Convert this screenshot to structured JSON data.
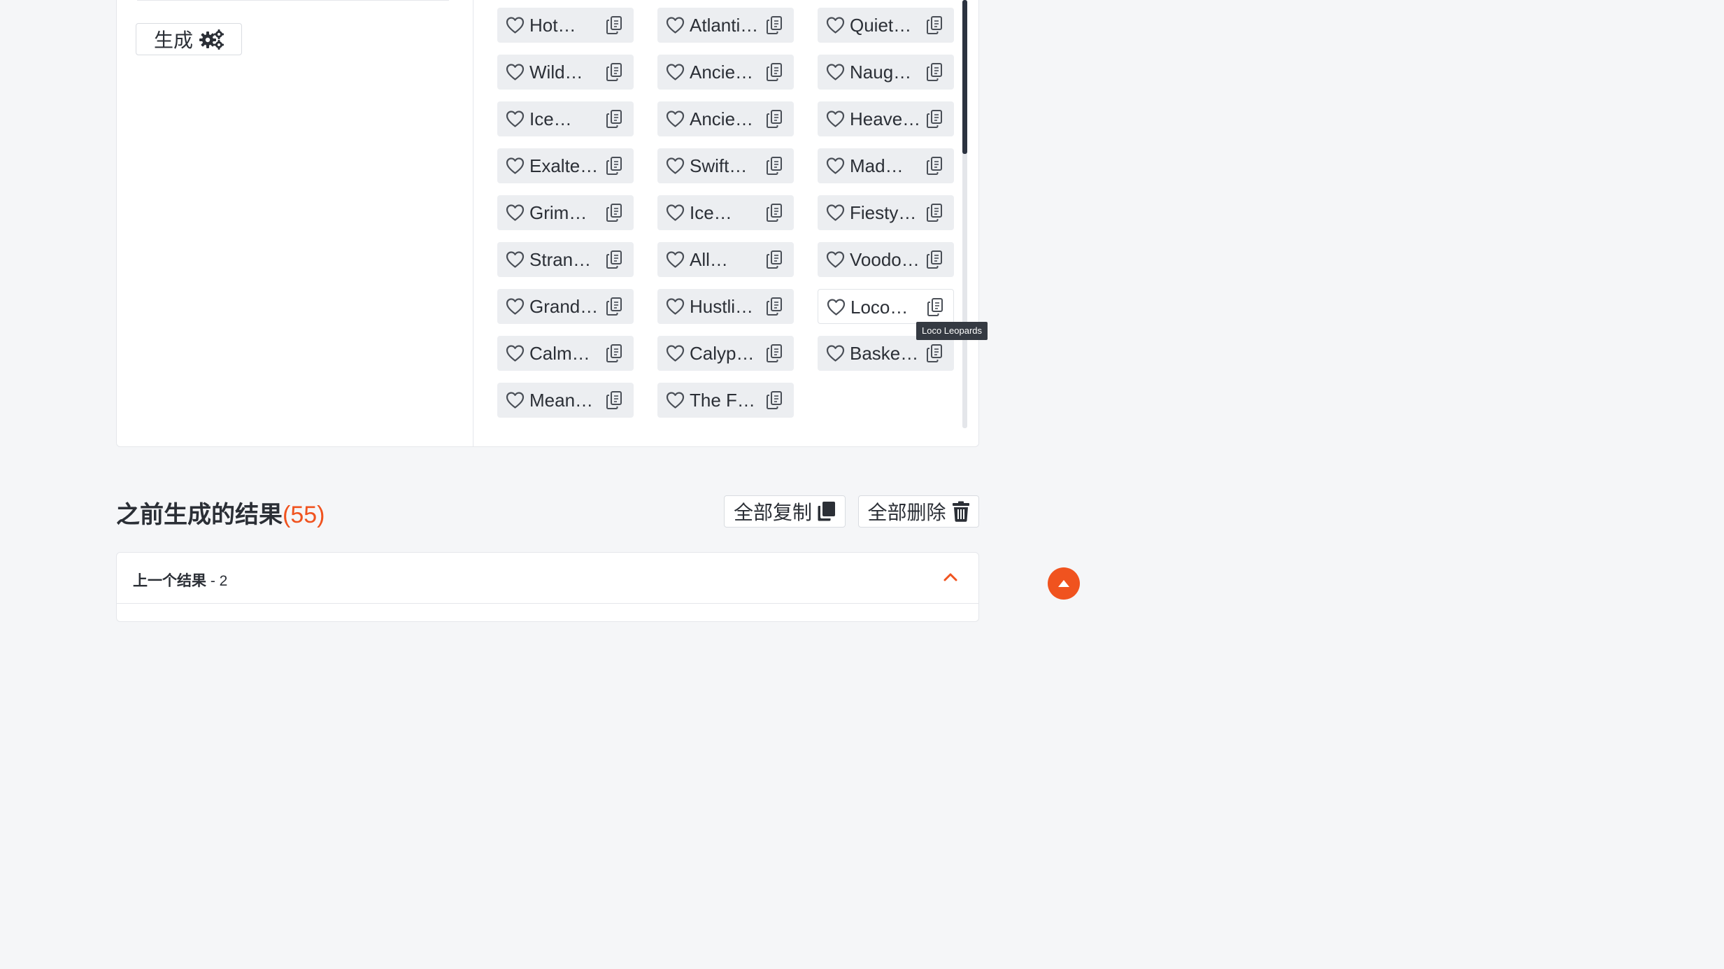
{
  "generator": {
    "generate_label": "生成",
    "generate_icon": "gears-icon"
  },
  "names": [
    {
      "label": "Hot…"
    },
    {
      "label": "Atlanti…"
    },
    {
      "label": "Quiet…"
    },
    {
      "label": "Wild…"
    },
    {
      "label": "Ancie…"
    },
    {
      "label": "Naug…"
    },
    {
      "label": "Ice…"
    },
    {
      "label": "Ancie…"
    },
    {
      "label": "Heave…"
    },
    {
      "label": "Exalte…"
    },
    {
      "label": "Swift…"
    },
    {
      "label": "Mad…"
    },
    {
      "label": "Grim…"
    },
    {
      "label": "Ice…"
    },
    {
      "label": "Fiesty…"
    },
    {
      "label": "Stran…"
    },
    {
      "label": "All…"
    },
    {
      "label": "Voodo…"
    },
    {
      "label": "Grand…"
    },
    {
      "label": "Hustli…"
    },
    {
      "label": "Loco…",
      "active": true
    },
    {
      "label": "Calm…"
    },
    {
      "label": "Calyp…"
    },
    {
      "label": "Baske…"
    },
    {
      "label": "Mean…"
    },
    {
      "label": "The F…"
    }
  ],
  "tooltip": "Loco Leopards",
  "previous": {
    "title": "之前生成的结果",
    "count": "(55)",
    "copy_all_label": "全部复制",
    "delete_all_label": "全部删除",
    "panel_label": "上一个结果",
    "panel_number": "- 2"
  },
  "colors": {
    "accent": "#f0531f",
    "chip_bg": "#eceef1",
    "scroll_thumb": "#2c3340"
  }
}
